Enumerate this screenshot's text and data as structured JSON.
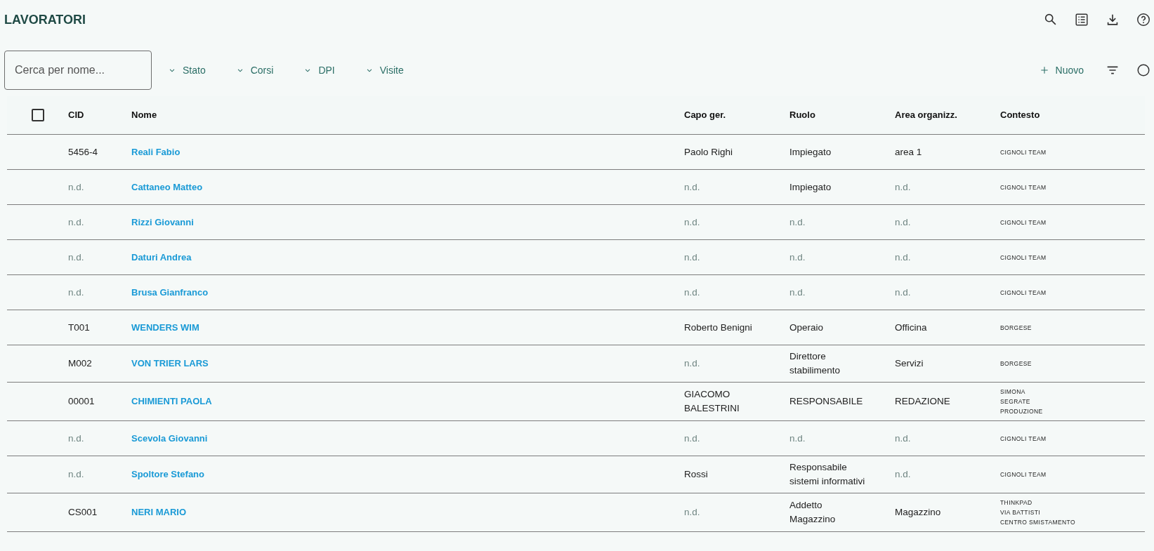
{
  "page": {
    "title": "LAVORATORI"
  },
  "header_icons": [
    {
      "kind": "search"
    },
    {
      "kind": "list"
    },
    {
      "kind": "download"
    },
    {
      "kind": "help"
    }
  ],
  "search": {
    "placeholder": "Cerca per nome..."
  },
  "filters": [
    {
      "label": "Stato"
    },
    {
      "label": "Corsi"
    },
    {
      "label": "DPI"
    },
    {
      "label": "Visite"
    }
  ],
  "actions": [
    {
      "kind": "new",
      "label": "Nuovo"
    },
    {
      "kind": "filter"
    },
    {
      "kind": "circle"
    }
  ],
  "table": {
    "select_all": {
      "checked": false
    },
    "columns": [
      "CID",
      "Nome",
      "Capo ger.",
      "Ruolo",
      "Area organizz.",
      "Contesto"
    ],
    "rows": [
      {
        "cid": {
          "text": "5456-4",
          "missing": false
        },
        "name": "Reali Fabio",
        "boss": {
          "text": "Paolo Righi",
          "missing": false
        },
        "role": {
          "text": "Impiegato",
          "missing": false
        },
        "area": {
          "text": "area 1",
          "missing": false
        },
        "context": [
          "CIGNOLI TEAM"
        ]
      },
      {
        "cid": {
          "text": "n.d.",
          "missing": true
        },
        "name": "Cattaneo Matteo",
        "boss": {
          "text": "n.d.",
          "missing": true
        },
        "role": {
          "text": "Impiegato",
          "missing": false
        },
        "area": {
          "text": "n.d.",
          "missing": true
        },
        "context": [
          "CIGNOLI TEAM"
        ]
      },
      {
        "cid": {
          "text": "n.d.",
          "missing": true
        },
        "name": "Rizzi Giovanni",
        "boss": {
          "text": "n.d.",
          "missing": true
        },
        "role": {
          "text": "n.d.",
          "missing": true
        },
        "area": {
          "text": "n.d.",
          "missing": true
        },
        "context": [
          "CIGNOLI TEAM"
        ]
      },
      {
        "cid": {
          "text": "n.d.",
          "missing": true
        },
        "name": "Daturi Andrea",
        "boss": {
          "text": "n.d.",
          "missing": true
        },
        "role": {
          "text": "n.d.",
          "missing": true
        },
        "area": {
          "text": "n.d.",
          "missing": true
        },
        "context": [
          "CIGNOLI TEAM"
        ]
      },
      {
        "cid": {
          "text": "n.d.",
          "missing": true
        },
        "name": "Brusa Gianfranco",
        "boss": {
          "text": "n.d.",
          "missing": true
        },
        "role": {
          "text": "n.d.",
          "missing": true
        },
        "area": {
          "text": "n.d.",
          "missing": true
        },
        "context": [
          "CIGNOLI TEAM"
        ]
      },
      {
        "cid": {
          "text": "T001",
          "missing": false
        },
        "name": "WENDERS WIM",
        "boss": {
          "text": "Roberto Benigni",
          "missing": false
        },
        "role": {
          "text": "Operaio",
          "missing": false
        },
        "area": {
          "text": "Officina",
          "missing": false
        },
        "context": [
          "BORGESE"
        ]
      },
      {
        "cid": {
          "text": "M002",
          "missing": false
        },
        "name": "VON TRIER LARS",
        "boss": {
          "text": "n.d.",
          "missing": true
        },
        "role": {
          "text": "Direttore stabilimento",
          "missing": false
        },
        "area": {
          "text": "Servizi",
          "missing": false
        },
        "context": [
          "BORGESE"
        ]
      },
      {
        "cid": {
          "text": "00001",
          "missing": false
        },
        "name": "CHIMIENTI PAOLA",
        "boss": {
          "text": "GIACOMO BALESTRINI",
          "missing": false
        },
        "role": {
          "text": "RESPONSABILE",
          "missing": false
        },
        "area": {
          "text": "REDAZIONE",
          "missing": false
        },
        "context": [
          "SIMONA",
          "SEGRATE",
          "PRODUZIONE"
        ]
      },
      {
        "cid": {
          "text": "n.d.",
          "missing": true
        },
        "name": "Scevola Giovanni",
        "boss": {
          "text": "n.d.",
          "missing": true
        },
        "role": {
          "text": "n.d.",
          "missing": true
        },
        "area": {
          "text": "n.d.",
          "missing": true
        },
        "context": [
          "CIGNOLI TEAM"
        ]
      },
      {
        "cid": {
          "text": "n.d.",
          "missing": true
        },
        "name": "Spoltore Stefano",
        "boss": {
          "text": "Rossi",
          "missing": false
        },
        "role": {
          "text": "Responsabile sistemi informativi",
          "missing": false
        },
        "area": {
          "text": "n.d.",
          "missing": true
        },
        "context": [
          "CIGNOLI TEAM"
        ]
      },
      {
        "cid": {
          "text": "CS001",
          "missing": false
        },
        "name": "NERI MARIO",
        "boss": {
          "text": "n.d.",
          "missing": true
        },
        "role": {
          "text": "Addetto Magazzino",
          "missing": false
        },
        "area": {
          "text": "Magazzino",
          "missing": false
        },
        "context": [
          "THINKPAD",
          "VIA BATTISTI",
          "CENTRO SMISTAMENTO"
        ]
      }
    ]
  }
}
